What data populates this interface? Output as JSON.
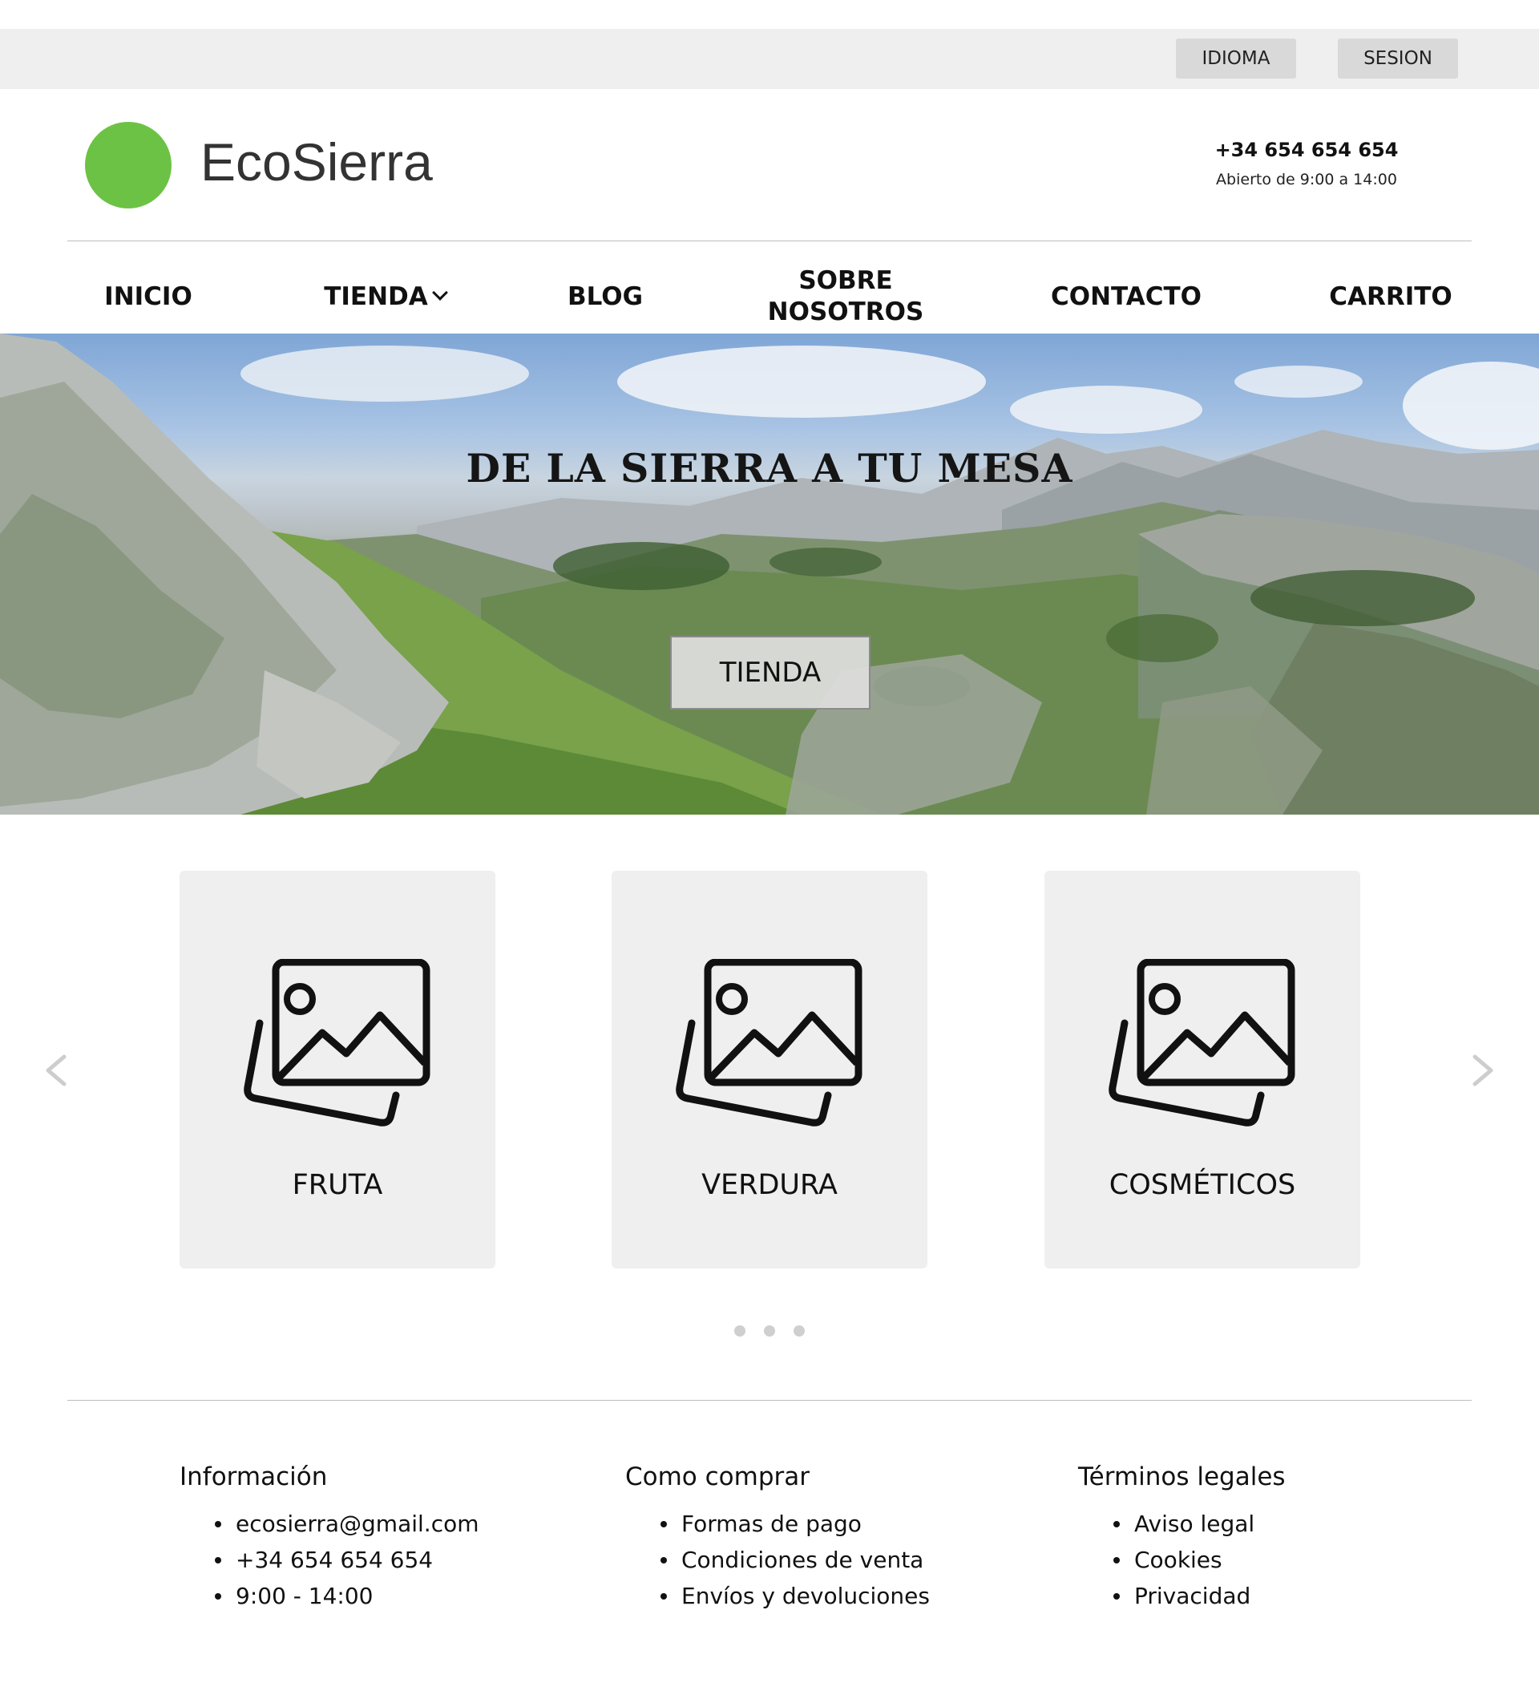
{
  "topbar": {
    "language_label": "IDIOMA",
    "session_label": "SESION"
  },
  "header": {
    "brand_name": "EcoSierra",
    "brand_color": "#6cc244",
    "phone": "+34 654 654 654",
    "hours": "Abierto de 9:00 a 14:00"
  },
  "nav": {
    "inicio": "INICIO",
    "tienda": "TIENDA",
    "blog": "BLOG",
    "sobre_line1": "SOBRE",
    "sobre_line2": "NOSOTROS",
    "contacto": "CONTACTO",
    "carrito": "CARRITO"
  },
  "hero": {
    "title": "DE LA SIERRA A TU MESA",
    "button_label": "TIENDA"
  },
  "categories": [
    {
      "label": "FRUTA",
      "icon": "image-placeholder-icon"
    },
    {
      "label": "VERDURA",
      "icon": "image-placeholder-icon"
    },
    {
      "label": "COSMÉTICOS",
      "icon": "image-placeholder-icon"
    }
  ],
  "carousel": {
    "page_count": 3
  },
  "footer": {
    "info": {
      "title": "Información",
      "items": [
        "ecosierra@gmail.com",
        "+34 654 654 654",
        "9:00 - 14:00"
      ]
    },
    "buy": {
      "title": "Como comprar",
      "items": [
        "Formas de pago",
        "Condiciones de venta",
        "Envíos y devoluciones"
      ]
    },
    "legal": {
      "title": "Términos legales",
      "items": [
        "Aviso legal",
        "Cookies",
        "Privacidad"
      ]
    }
  }
}
